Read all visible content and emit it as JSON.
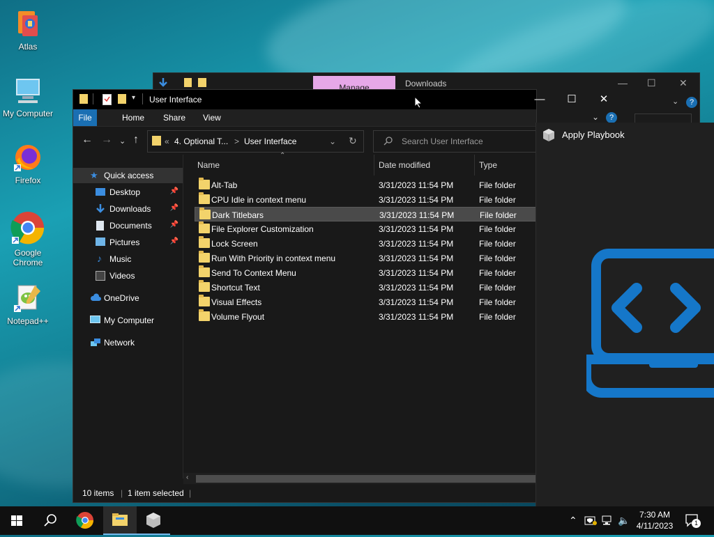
{
  "desktop": {
    "icons": [
      {
        "label": "Atlas"
      },
      {
        "label": "My Computer"
      },
      {
        "label": "Firefox"
      },
      {
        "label": "Google Chrome"
      },
      {
        "label": "Notepad++"
      }
    ]
  },
  "back_window": {
    "manage_tab": "Manage",
    "tab": "Downloads"
  },
  "explorer": {
    "title": "User Interface",
    "window_controls": {
      "minimize": "—",
      "maximize": "☐",
      "close": "✕"
    },
    "ribbon_tabs": [
      "File",
      "Home",
      "Share",
      "View"
    ],
    "breadcrumb": {
      "prefix": "«",
      "parent": "4. Optional T...",
      "separator": ">",
      "current": "User Interface"
    },
    "search_placeholder": "Search User Interface",
    "nav": [
      {
        "label": "Quick access",
        "selected": true
      },
      {
        "label": "Desktop",
        "pinned": true
      },
      {
        "label": "Downloads",
        "pinned": true
      },
      {
        "label": "Documents",
        "pinned": true
      },
      {
        "label": "Pictures",
        "pinned": true
      },
      {
        "label": "Music"
      },
      {
        "label": "Videos"
      },
      {
        "label": "OneDrive"
      },
      {
        "label": "My Computer"
      },
      {
        "label": "Network"
      }
    ],
    "columns": [
      "Name",
      "Date modified",
      "Type"
    ],
    "rows": [
      {
        "name": "Alt-Tab",
        "date": "3/31/2023 11:54 PM",
        "type": "File folder"
      },
      {
        "name": "CPU Idle in context menu",
        "date": "3/31/2023 11:54 PM",
        "type": "File folder"
      },
      {
        "name": "Dark Titlebars",
        "date": "3/31/2023 11:54 PM",
        "type": "File folder",
        "selected": true
      },
      {
        "name": "File Explorer Customization",
        "date": "3/31/2023 11:54 PM",
        "type": "File folder"
      },
      {
        "name": "Lock Screen",
        "date": "3/31/2023 11:54 PM",
        "type": "File folder"
      },
      {
        "name": "Run With Priority in context menu",
        "date": "3/31/2023 11:54 PM",
        "type": "File folder"
      },
      {
        "name": "Send To Context Menu",
        "date": "3/31/2023 11:54 PM",
        "type": "File folder"
      },
      {
        "name": "Shortcut Text",
        "date": "3/31/2023 11:54 PM",
        "type": "File folder"
      },
      {
        "name": "Visual Effects",
        "date": "3/31/2023 11:54 PM",
        "type": "File folder"
      },
      {
        "name": "Volume Flyout",
        "date": "3/31/2023 11:54 PM",
        "type": "File folder"
      }
    ],
    "status": {
      "count": "10 items",
      "selection": "1 item selected"
    }
  },
  "playbook": {
    "title": "Apply Playbook"
  },
  "taskbar": {
    "time": "7:30 AM",
    "date": "4/11/2023",
    "notification_count": "1"
  },
  "colors": {
    "accent": "#1a6fb3",
    "folder": "#f3d36b",
    "manage_tab": "#e6a8e8",
    "playbook_logo": "#1577c9"
  }
}
